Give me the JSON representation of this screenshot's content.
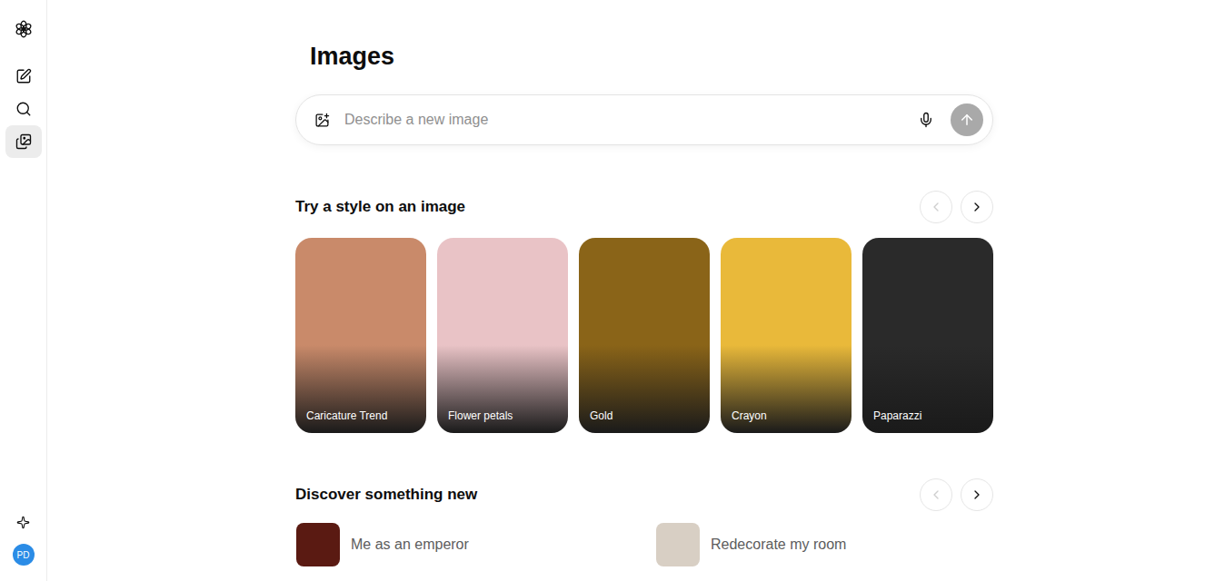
{
  "sidebar": {
    "items": [
      {
        "selected": false
      },
      {
        "selected": false
      },
      {
        "selected": true
      }
    ],
    "avatar": {
      "initials": "PD"
    }
  },
  "page": {
    "title": "Images"
  },
  "prompt": {
    "placeholder": "Describe a new image",
    "send_disabled": true
  },
  "styles": {
    "title": "Try a style on an image",
    "prev_disabled": true,
    "next_disabled": false,
    "cards": [
      {
        "label": "Caricature Trend",
        "color": "#c98a6a"
      },
      {
        "label": "Flower petals",
        "color": "#e9c3c6"
      },
      {
        "label": "Gold",
        "color": "#8a6418"
      },
      {
        "label": "Crayon",
        "color": "#e9b93a"
      },
      {
        "label": "Paparazzi",
        "color": "#2a2a2a"
      }
    ]
  },
  "discover": {
    "title": "Discover something new",
    "prev_disabled": true,
    "next_disabled": false,
    "items": [
      {
        "label": "Me as an emperor",
        "color": "#5a1a12"
      },
      {
        "label": "Redecorate my room",
        "color": "#d8cfc4"
      }
    ]
  }
}
